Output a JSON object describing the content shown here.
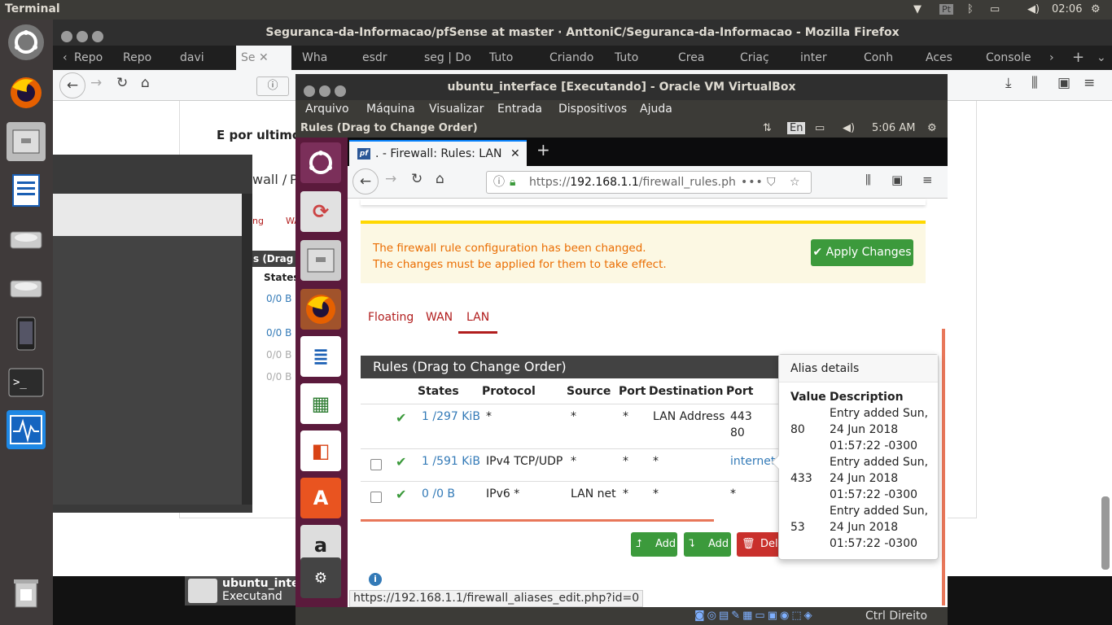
{
  "host": {
    "panel_title": "Terminal",
    "clock": "02:06",
    "firefox_title": "Seguranca-da-Informacao/pfSense at master · AnttoniC/Seguranca-da-Informacao - Mozilla Firefox",
    "tabs": [
      "Repo",
      "Repo",
      "davi",
      "Se",
      "Wha",
      "esdr",
      "seg | Do",
      "Tuto",
      "Criando",
      "Tuto",
      "Crea",
      "Criaç",
      "inter",
      "Conh",
      "Aces",
      "Console"
    ],
    "doc_heading": "E por ultimo",
    "peek": [
      "wall /",
      "P",
      "ng",
      "WA",
      "s (Drag to",
      "States",
      "0/0 B",
      "0/0 B",
      "0/0 B",
      "0/0 B"
    ],
    "taskbar_vbox_name": "ubuntu_inte",
    "taskbar_vbox_state": "Executand"
  },
  "vbox": {
    "title": "ubuntu_interface [Executando] - Oracle VM VirtualBox",
    "menu": [
      "Arquivo",
      "Máquina",
      "Visualizar",
      "Entrada",
      "Dispositivos",
      "Ajuda"
    ],
    "host_key": "Ctrl Direito"
  },
  "guest": {
    "panel_title": "Rules (Drag to Change Order)",
    "lang": "En",
    "clock": "5:06 AM",
    "tab_title": ". - Firewall: Rules: LAN",
    "url_prefix": "https://",
    "url_host": "192.168.1.1",
    "url_path": "/firewall_rules.php",
    "notice_line1": "The firewall rule configuration has been changed.",
    "notice_line2": "The changes must be applied for them to take effect.",
    "apply_label": "Apply Changes",
    "iface_tabs": [
      "Floating",
      "WAN",
      "LAN"
    ],
    "columns": [
      "States",
      "Protocol",
      "Source",
      "Port",
      "Destination",
      "Port"
    ],
    "rules": [
      {
        "states": "1 /297 KiB",
        "protocol": "*",
        "source": "*",
        "port": "*",
        "destination": "LAN Address",
        "dport": "443",
        "dport2": "80"
      },
      {
        "states": "1 /591 KiB",
        "protocol": "IPv4 TCP/UDP",
        "source": "*",
        "port": "*",
        "destination": "*",
        "dport": "internet"
      },
      {
        "states": "0 /0 B",
        "protocol": "IPv6 *",
        "source": "LAN net",
        "port": "*",
        "destination": "*",
        "dport": "*"
      }
    ],
    "buttons": {
      "add1": "Add",
      "add2": "Add",
      "delete": "Dele"
    },
    "popover": {
      "title": "Alias details",
      "col_value": "Value",
      "col_desc": "Description",
      "entries": [
        {
          "value": "80",
          "l1": "Entry added Sun,",
          "l2": "24 Jun 2018",
          "l3": "01:57:22 -0300"
        },
        {
          "value": "433",
          "l1": "Entry added Sun,",
          "l2": "24 Jun 2018",
          "l3": "01:57:22 -0300"
        },
        {
          "value": "53",
          "l1": "Entry added Sun,",
          "l2": "24 Jun 2018",
          "l3": "01:57:22 -0300"
        }
      ]
    },
    "status_url": "https://192.168.1.1/firewall_aliases_edit.php?id=0"
  },
  "colors": {
    "pf_red": "#b11d1d",
    "apply_green": "#3c9a3c",
    "notice_orange": "#ea6c00",
    "link_blue": "#337ab7",
    "ubuntu_launcher": "#5b1a3c"
  }
}
